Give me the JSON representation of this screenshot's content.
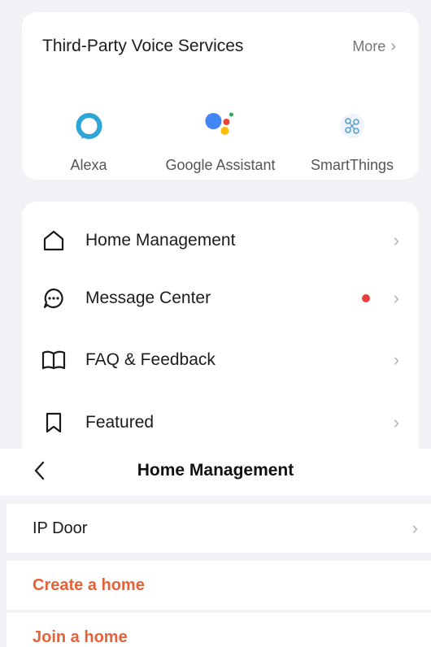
{
  "voice_services": {
    "title": "Third-Party Voice Services",
    "more_label": "More",
    "items": [
      {
        "label": "Alexa",
        "icon": "alexa-icon",
        "color": "#2fa6d8"
      },
      {
        "label": "Google Assistant",
        "icon": "google-assistant-icon",
        "color": "#4285f4"
      },
      {
        "label": "SmartThings",
        "icon": "smartthings-icon",
        "color": "#5aa0c8"
      }
    ]
  },
  "menu": {
    "items": [
      {
        "label": "Home Management",
        "icon": "home-icon"
      },
      {
        "label": "Message Center",
        "icon": "message-icon",
        "badge_color": "#e8413d"
      },
      {
        "label": "FAQ & Feedback",
        "icon": "book-icon"
      },
      {
        "label": "Featured",
        "icon": "bookmark-icon"
      }
    ]
  },
  "home_management": {
    "title": "Home Management",
    "homes": [
      {
        "label": "IP Door"
      }
    ],
    "actions": [
      {
        "label": "Create a home"
      },
      {
        "label": "Join a home"
      }
    ],
    "accent_color": "#e4623a"
  }
}
